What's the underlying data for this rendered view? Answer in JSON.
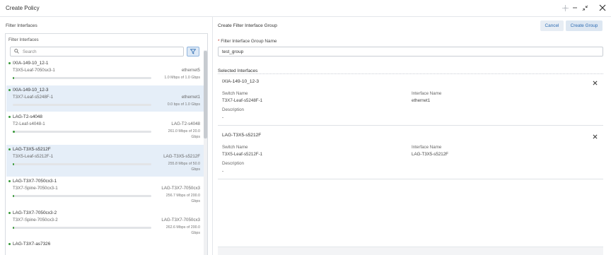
{
  "window": {
    "title": "Create Policy"
  },
  "left": {
    "section_title": "Filter Interfaces",
    "panel_title": "Filter Interfaces",
    "search_placeholder": "Search",
    "items": [
      {
        "name": "IXIA-149-10_12-1",
        "switch": "T3X5-Leaf-7050sx3-1",
        "interface": "ethernet5",
        "rate": "1.0 Mbps of 1.0 Gbps",
        "rate_lines": [
          "1.0 Mbps of 1.0 Gbps"
        ],
        "utilization_pct": 0.1,
        "selected": false
      },
      {
        "name": "IXIA-149-10_12-3",
        "switch": "T3X7-Leaf-s5248F-1",
        "interface": "ethernet1",
        "rate": "0.0 bps of 1.0 Gbps",
        "rate_lines": [
          "0.0 bps of 1.0 Gbps"
        ],
        "utilization_pct": 0,
        "selected": true
      },
      {
        "name": "LAG-T2-s4048",
        "switch": "T2-Leaf-s4048-1",
        "interface": "LAG-T2-s4048",
        "rate": "261.0 Mbps of 20.0 Gbps",
        "rate_lines": [
          "261.0 Mbps of 20.0",
          "Gbps"
        ],
        "utilization_pct": 1.3,
        "selected": false
      },
      {
        "name": "LAG-T3X5-s5212F",
        "switch": "T3X5-Leaf-s5212F-1",
        "interface": "LAG-T3X5-s5212F",
        "rate": "255.8 Mbps of 50.0 Gbps",
        "rate_lines": [
          "255.8 Mbps of 50.0",
          "Gbps"
        ],
        "utilization_pct": 0.5,
        "selected": true
      },
      {
        "name": "LAG-T3X7-7050cx3-1",
        "switch": "T3X7-Spine-7050cx3-1",
        "interface": "LAG-T3X7-7050cx3",
        "rate": "256.7 Mbps of 200.0 Gbps",
        "rate_lines": [
          "256.7 Mbps of 200.0",
          "Gbps"
        ],
        "utilization_pct": 0.13,
        "selected": false
      },
      {
        "name": "LAG-T3X7-7050cx3-2",
        "switch": "T3X7-Spine-7050cx3-2",
        "interface": "LAG-T3X7-7050cx3",
        "rate": "262.6 Mbps of 200.0 Gbps",
        "rate_lines": [
          "262.6 Mbps of 200.0",
          "Gbps"
        ],
        "utilization_pct": 0.13,
        "selected": false
      },
      {
        "name": "LAG-T3X7-as7326",
        "switch": "",
        "interface": "",
        "rate": "",
        "rate_lines": [],
        "utilization_pct": null,
        "selected": false
      }
    ]
  },
  "right": {
    "title": "Create Filter Interface Group",
    "cancel_label": "Cancel",
    "create_label": "Create Group",
    "name_label_required": "*",
    "name_label": "Filter Interface Group Name",
    "name_value": "test_group",
    "selected_title": "Selected Interfaces",
    "switch_label": "Switch Name",
    "interface_label": "Interface Name",
    "description_label": "Description",
    "selected": [
      {
        "name": "IXIA-149-10_12-3",
        "switch": "T3X7-Leaf-s5248F-1",
        "interface": "ethernet1",
        "description": "-"
      },
      {
        "name": "LAG-T3X5-s5212F",
        "switch": "T3X5-Leaf-s5212F-1",
        "interface": "LAG-T3X5-s5212F",
        "description": "-"
      }
    ]
  },
  "icons": {
    "search": "search-icon",
    "filter": "filter-icon",
    "close": "close-icon",
    "minimize": "minimize-icon",
    "collapse": "collapse-icon",
    "move": "move-icon"
  },
  "colors": {
    "accent": "#2f6db3",
    "selected_row": "#e5eef8",
    "status_up": "#3a9a3a"
  }
}
